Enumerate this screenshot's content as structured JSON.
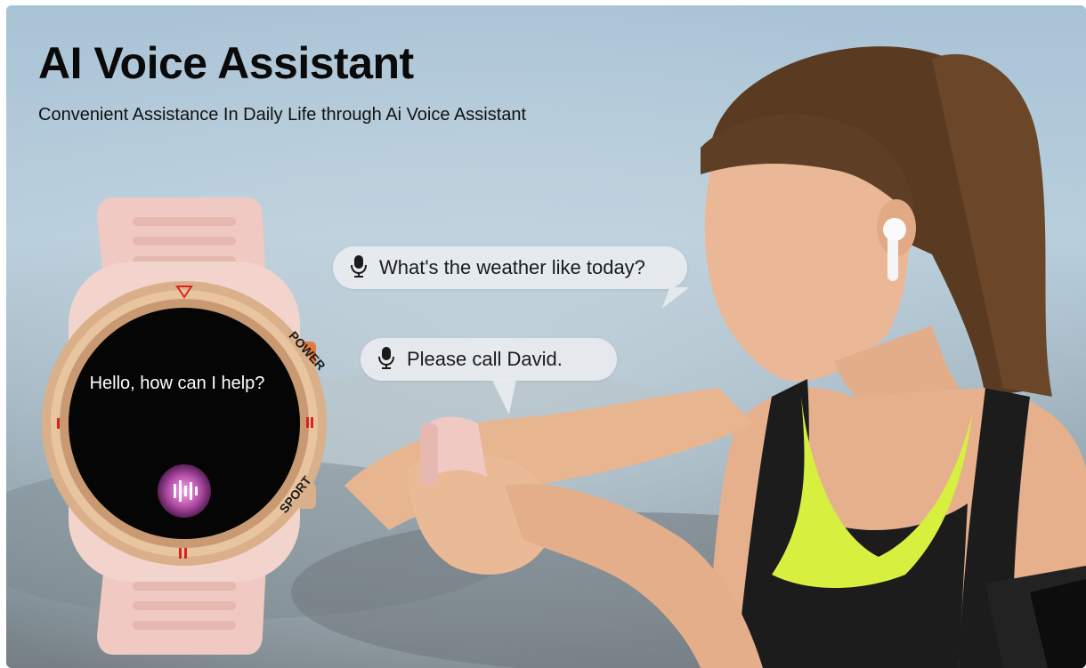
{
  "header": {
    "title": "AI Voice Assistant",
    "subtitle": "Convenient Assistance In Daily Life through Ai Voice Assistant"
  },
  "bubbles": [
    {
      "text": "What's the weather like today?",
      "icon": "microphone-icon"
    },
    {
      "text": "Please call David.",
      "icon": "microphone-icon"
    }
  ],
  "watch": {
    "screen_text": "Hello, how can I help?",
    "bezel_labels": {
      "top_right": "POWER",
      "bottom_right": "SPORT"
    }
  },
  "colors": {
    "watch_band": "#f0c9c2",
    "bezel": "#d9b08a",
    "screen": "#050505",
    "marker": "#d9231f",
    "tank_top": "#1c1c1c",
    "sports_bra": "#d7f03f"
  }
}
